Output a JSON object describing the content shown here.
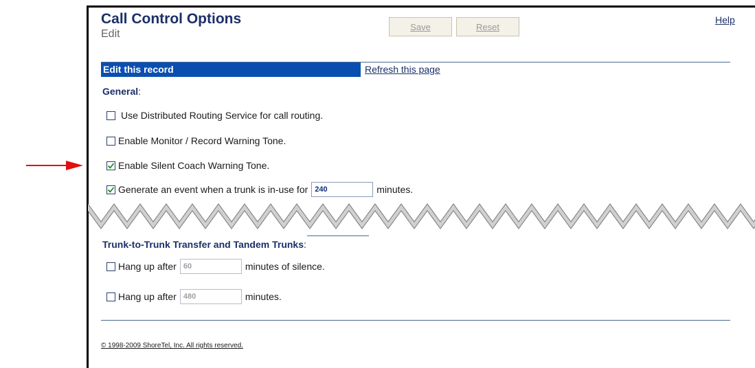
{
  "header": {
    "title": "Call Control Options",
    "subtitle": "Edit",
    "save_label": "Save",
    "reset_label": "Reset",
    "help_label": "Help"
  },
  "record_bar": {
    "label": "Edit this record",
    "refresh_label": "Refresh this page"
  },
  "general": {
    "heading": "General",
    "items": [
      {
        "label": "Use Distributed Routing Service for call routing.",
        "checked": false
      },
      {
        "label": "Enable Monitor / Record Warning Tone.",
        "checked": false
      },
      {
        "label": "Enable Silent Coach Warning Tone.",
        "checked": true
      },
      {
        "label_before": "Generate an event when a trunk is in-use for",
        "value": "240",
        "label_after": "minutes.",
        "checked": true
      }
    ]
  },
  "trunk": {
    "heading": "Trunk-to-Trunk Transfer and Tandem Trunks",
    "items": [
      {
        "label_before": "Hang up after",
        "value": "60",
        "label_after": "minutes of silence.",
        "checked": false
      },
      {
        "label_before": "Hang up after",
        "value": "480",
        "label_after": "minutes.",
        "checked": false
      }
    ]
  },
  "footer": {
    "copyright": "© 1998-2009 ShoreTel, Inc. All rights reserved."
  },
  "colors": {
    "accent": "#0a4fb0",
    "title": "#1b2f68",
    "callout_arrow": "#e01010"
  }
}
